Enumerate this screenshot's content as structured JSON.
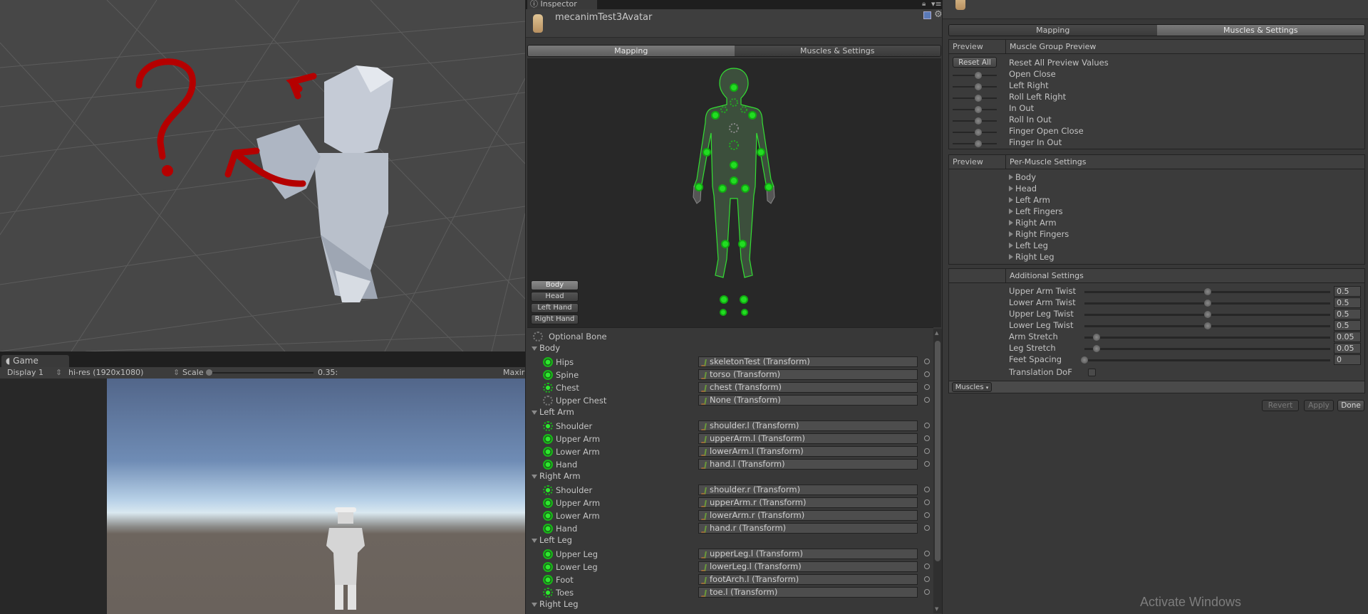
{
  "scene": {
    "annotation": "red question mark and arrows drawn over character"
  },
  "game": {
    "tab_label": "Game",
    "display": "Display 1",
    "resolution": "hi-res (1920x1080)",
    "scale_label": "Scale",
    "scale_value": "0.35:",
    "maximize_label": "Maxir"
  },
  "inspector": {
    "tab_label": "Inspector",
    "asset_name": "mecanimTest3Avatar",
    "tabs": [
      {
        "label": "Mapping",
        "active": true
      },
      {
        "label": "Muscles & Settings",
        "active": false
      }
    ],
    "body_buttons": [
      {
        "label": "Body",
        "active": true
      },
      {
        "label": "Head",
        "active": false
      },
      {
        "label": "Left Hand",
        "active": false
      },
      {
        "label": "Right Hand",
        "active": false
      }
    ],
    "optional_bone_label": "Optional Bone",
    "groups": [
      {
        "name": "Body",
        "bones": [
          {
            "name": "Hips",
            "type": "req",
            "value": "skeletonTest (Transform)"
          },
          {
            "name": "Spine",
            "type": "req",
            "value": "torso (Transform)"
          },
          {
            "name": "Chest",
            "type": "opt",
            "value": "chest (Transform)"
          },
          {
            "name": "Upper Chest",
            "type": "none",
            "value": "None (Transform)"
          }
        ]
      },
      {
        "name": "Left Arm",
        "bones": [
          {
            "name": "Shoulder",
            "type": "opt",
            "value": "shoulder.l (Transform)"
          },
          {
            "name": "Upper Arm",
            "type": "req",
            "value": "upperArm.l (Transform)"
          },
          {
            "name": "Lower Arm",
            "type": "req",
            "value": "lowerArm.l (Transform)"
          },
          {
            "name": "Hand",
            "type": "req",
            "value": "hand.l (Transform)"
          }
        ]
      },
      {
        "name": "Right Arm",
        "bones": [
          {
            "name": "Shoulder",
            "type": "opt",
            "value": "shoulder.r (Transform)"
          },
          {
            "name": "Upper Arm",
            "type": "req",
            "value": "upperArm.r (Transform)"
          },
          {
            "name": "Lower Arm",
            "type": "req",
            "value": "lowerArm.r (Transform)"
          },
          {
            "name": "Hand",
            "type": "req",
            "value": "hand.r (Transform)"
          }
        ]
      },
      {
        "name": "Left Leg",
        "bones": [
          {
            "name": "Upper Leg",
            "type": "req",
            "value": "upperLeg.l (Transform)"
          },
          {
            "name": "Lower Leg",
            "type": "req",
            "value": "lowerLeg.l (Transform)"
          },
          {
            "name": "Foot",
            "type": "req",
            "value": "footArch.l (Transform)"
          },
          {
            "name": "Toes",
            "type": "opt",
            "value": "toe.l (Transform)"
          }
        ]
      },
      {
        "name": "Right Leg",
        "bones": []
      }
    ]
  },
  "muscles": {
    "tabs": [
      {
        "label": "Mapping",
        "active": false
      },
      {
        "label": "Muscles & Settings",
        "active": true
      }
    ],
    "group_preview": {
      "col1": "Preview",
      "col2": "Muscle Group Preview",
      "reset_button": "Reset All",
      "reset_label": "Reset All Preview Values",
      "items": [
        "Open Close",
        "Left Right",
        "Roll Left Right",
        "In Out",
        "Roll In Out",
        "Finger Open Close",
        "Finger In Out"
      ]
    },
    "per_muscle": {
      "col1": "Preview",
      "col2": "Per-Muscle Settings",
      "items": [
        "Body",
        "Head",
        "Left Arm",
        "Left Fingers",
        "Right Arm",
        "Right Fingers",
        "Left Leg",
        "Right Leg"
      ]
    },
    "additional": {
      "title": "Additional Settings",
      "sliders": [
        {
          "label": "Upper Arm Twist",
          "value": "0.5",
          "fraction": 0.5
        },
        {
          "label": "Lower Arm Twist",
          "value": "0.5",
          "fraction": 0.5
        },
        {
          "label": "Upper Leg Twist",
          "value": "0.5",
          "fraction": 0.5
        },
        {
          "label": "Lower Leg Twist",
          "value": "0.5",
          "fraction": 0.5
        },
        {
          "label": "Arm Stretch",
          "value": "0.05",
          "fraction": 0.05
        },
        {
          "label": "Leg Stretch",
          "value": "0.05",
          "fraction": 0.05
        },
        {
          "label": "Feet Spacing",
          "value": "0",
          "fraction": 0
        }
      ],
      "translation_dof_label": "Translation DoF",
      "translation_dof": false
    },
    "muscles_dropdown": "Muscles",
    "buttons": {
      "revert": "Revert",
      "apply": "Apply",
      "done": "Done"
    }
  },
  "watermark": "Activate Windows"
}
